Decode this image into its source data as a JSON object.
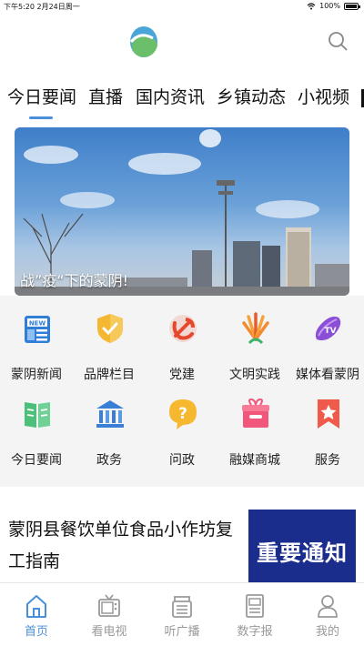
{
  "status_bar": {
    "time_date": "下午5:20  2月24日周一",
    "battery": "100%"
  },
  "tabs": [
    "今日要闻",
    "直播",
    "国内资讯",
    "乡镇动态",
    "小视频"
  ],
  "banner": {
    "caption": "战”疫“下的蒙阴!"
  },
  "grid": [
    {
      "label": "蒙阴新闻",
      "icon": "news-icon"
    },
    {
      "label": "品牌栏目",
      "icon": "brand-shield-icon"
    },
    {
      "label": "党建",
      "icon": "party-emblem-icon"
    },
    {
      "label": "文明实践",
      "icon": "civilization-fan-icon"
    },
    {
      "label": "媒体看蒙阴",
      "icon": "tv-icon"
    },
    {
      "label": "今日要闻",
      "icon": "book-icon"
    },
    {
      "label": "政务",
      "icon": "government-building-icon"
    },
    {
      "label": "问政",
      "icon": "question-bubble-icon"
    },
    {
      "label": "融媒商城",
      "icon": "gift-box-icon"
    },
    {
      "label": "服务",
      "icon": "star-ribbon-icon"
    }
  ],
  "article": {
    "title": "蒙阴县餐饮单位食品小作坊复工指南",
    "thumb_text": "重要通知"
  },
  "bottom_nav": [
    {
      "label": "首页",
      "icon": "home-icon"
    },
    {
      "label": "看电视",
      "icon": "tv-set-icon"
    },
    {
      "label": "听广播",
      "icon": "radio-icon"
    },
    {
      "label": "数字报",
      "icon": "newspaper-icon"
    },
    {
      "label": "我的",
      "icon": "user-icon"
    }
  ],
  "colors": {
    "accent": "#4a90d9",
    "inactive": "#999999",
    "thumb_bg": "#1a2c8c"
  }
}
